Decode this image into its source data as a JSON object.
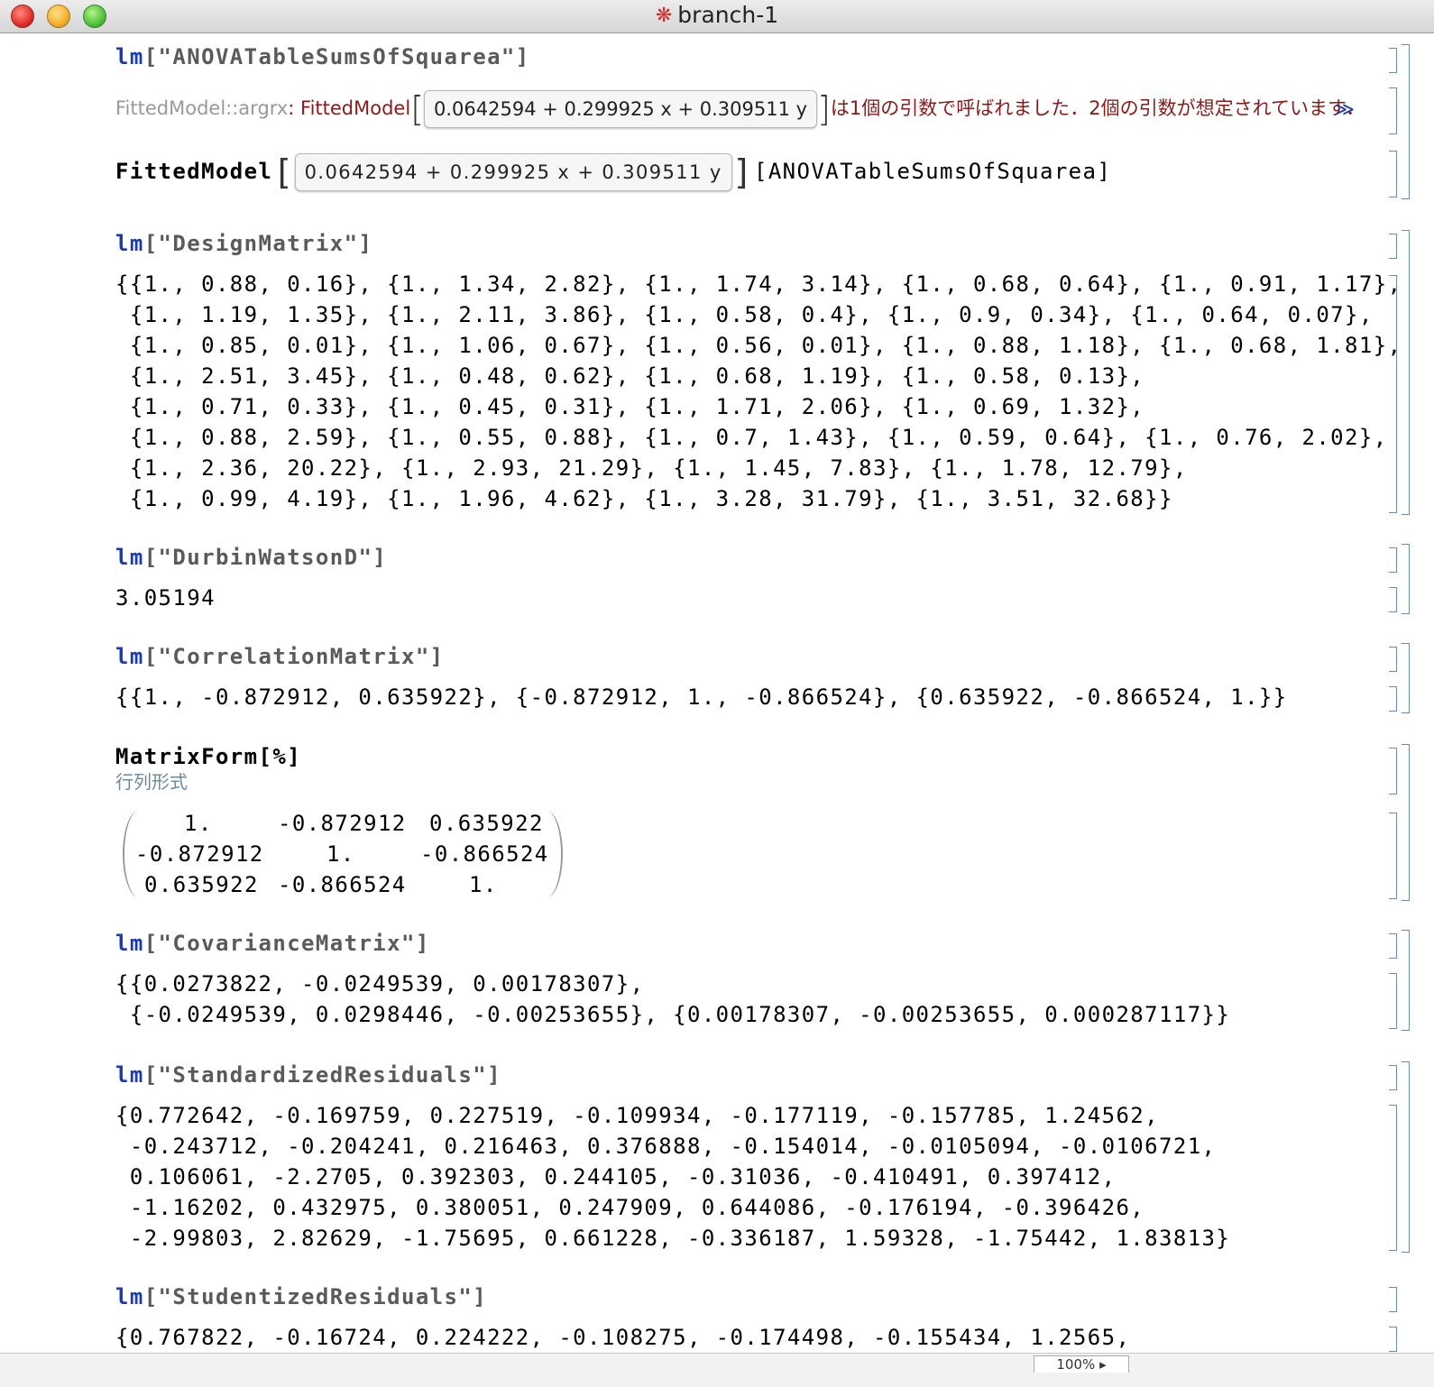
{
  "window": {
    "title": "branch-1"
  },
  "cells": {
    "c1_input_fn": "lm",
    "c1_input_arg": "[\"ANOVATableSumsOfSquarea\"]",
    "c1_msg_name": "FittedModel::argrx",
    "c1_msg_sep": ": FittedModel",
    "c1_msg_box": "0.0642594 + 0.299925 x + 0.309511 y",
    "c1_msg_text": "は1個の引数で呼ばれました．2個の引数が想定されています．",
    "c1_msg_more": "≫",
    "c1_out_head": "FittedModel",
    "c1_out_box": "0.0642594 + 0.299925 x + 0.309511 y",
    "c1_out_tail": "[ANOVATableSumsOfSquarea]",
    "c2_input_fn": "lm",
    "c2_input_arg": "[\"DesignMatrix\"]",
    "c2_out_lines": [
      "{{1., 0.88, 0.16}, {1., 1.34, 2.82}, {1., 1.74, 3.14}, {1., 0.68, 0.64}, {1., 0.91, 1.17},",
      " {1., 1.19, 1.35}, {1., 2.11, 3.86}, {1., 0.58, 0.4}, {1., 0.9, 0.34}, {1., 0.64, 0.07},",
      " {1., 0.85, 0.01}, {1., 1.06, 0.67}, {1., 0.56, 0.01}, {1., 0.88, 1.18}, {1., 0.68, 1.81},",
      " {1., 2.51, 3.45}, {1., 0.48, 0.62}, {1., 0.68, 1.19}, {1., 0.58, 0.13},",
      " {1., 0.71, 0.33}, {1., 0.45, 0.31}, {1., 1.71, 2.06}, {1., 0.69, 1.32},",
      " {1., 0.88, 2.59}, {1., 0.55, 0.88}, {1., 0.7, 1.43}, {1., 0.59, 0.64}, {1., 0.76, 2.02},",
      " {1., 2.36, 20.22}, {1., 2.93, 21.29}, {1., 1.45, 7.83}, {1., 1.78, 12.79},",
      " {1., 0.99, 4.19}, {1., 1.96, 4.62}, {1., 3.28, 31.79}, {1., 3.51, 32.68}}"
    ],
    "c3_input_fn": "lm",
    "c3_input_arg": "[\"DurbinWatsonD\"]",
    "c3_out": "3.05194",
    "c4_input_fn": "lm",
    "c4_input_arg": "[\"CorrelationMatrix\"]",
    "c4_out": "{{1., -0.872912, 0.635922}, {-0.872912, 1., -0.866524}, {0.635922, -0.866524, 1.}}",
    "c5_input": "MatrixForm[%]",
    "c5_label": "行列形式",
    "c5_matrix": [
      [
        "1.",
        "-0.872912",
        "0.635922"
      ],
      [
        "-0.872912",
        "1.",
        "-0.866524"
      ],
      [
        "0.635922",
        "-0.866524",
        "1."
      ]
    ],
    "c6_input_fn": "lm",
    "c6_input_arg": "[\"CovarianceMatrix\"]",
    "c6_out_lines": [
      "{{0.0273822, -0.0249539, 0.00178307},",
      " {-0.0249539, 0.0298446, -0.00253655}, {0.00178307, -0.00253655, 0.000287117}}"
    ],
    "c7_input_fn": "lm",
    "c7_input_arg": "[\"StandardizedResiduals\"]",
    "c7_out_lines": [
      "{0.772642, -0.169759, 0.227519, -0.109934, -0.177119, -0.157785, 1.24562,",
      " -0.243712, -0.204241, 0.216463, 0.376888, -0.154014, -0.0105094, -0.0106721,",
      " 0.106061, -2.2705, 0.392303, 0.244105, -0.31036, -0.410491, 0.397412,",
      " -1.16202, 0.432975, 0.380051, 0.247909, 0.644086, -0.176194, -0.396426,",
      " -2.99803, 2.82629, -1.75695, 0.661228, -0.336187, 1.59328, -1.75442, 1.83813}"
    ],
    "c8_input_fn": "lm",
    "c8_input_arg": "[\"StudentizedResiduals\"]",
    "c8_out_lines": [
      "{0.767822, -0.16724, 0.224222, -0.108275, -0.174498, -0.155434, 1.2565,"
    ]
  },
  "statusbar": {
    "zoom": "100%"
  }
}
